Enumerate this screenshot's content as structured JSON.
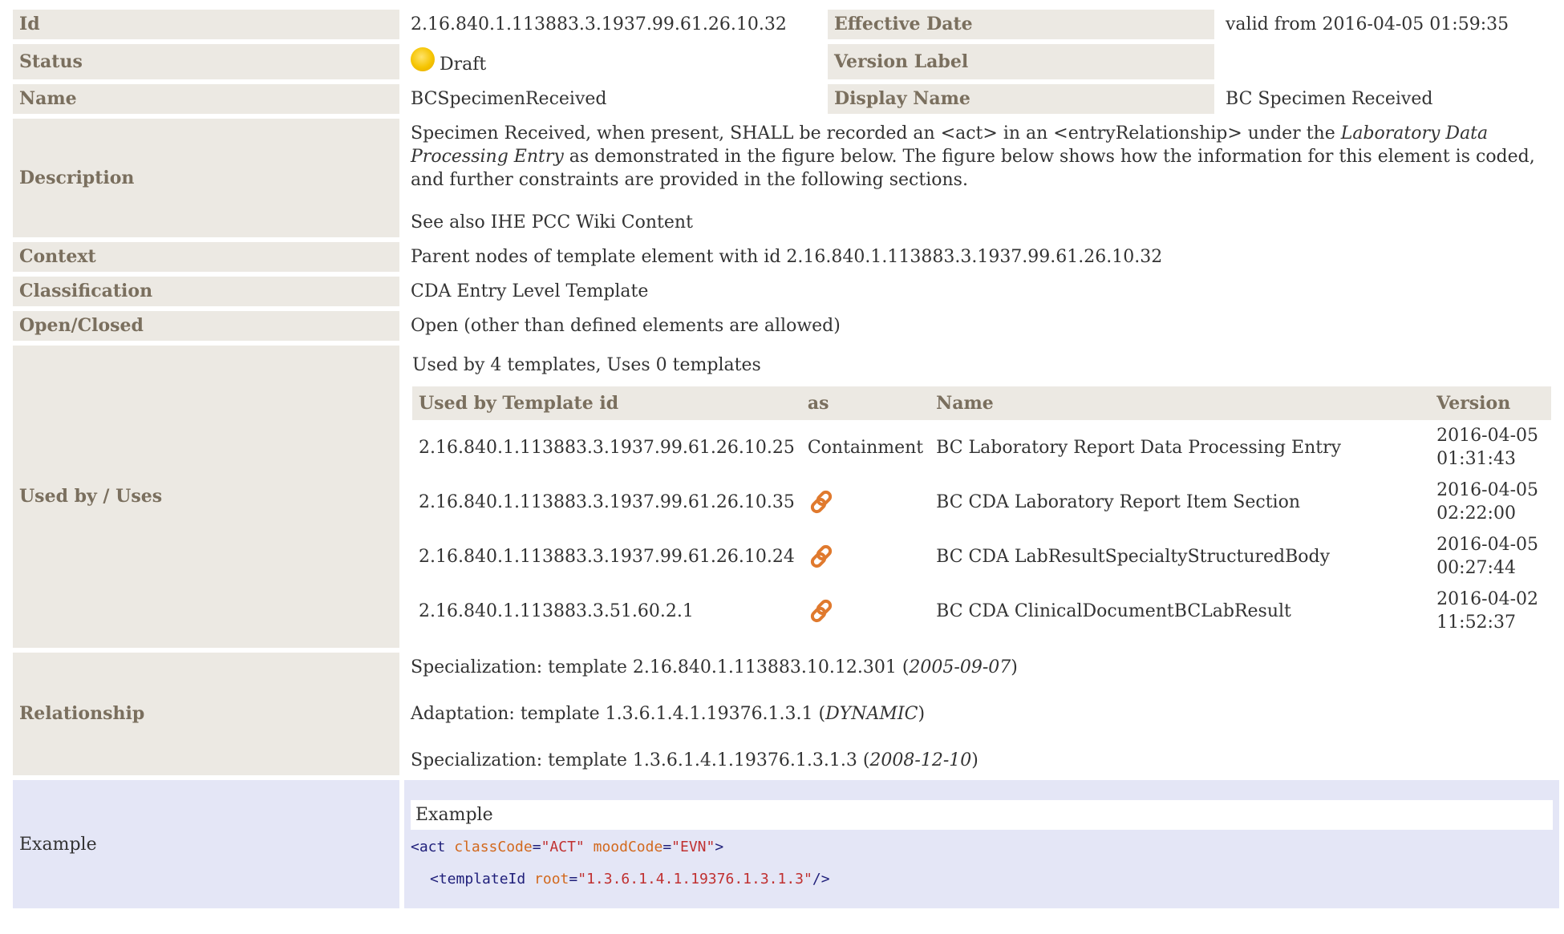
{
  "rows": {
    "id": {
      "label": "Id",
      "value": "2.16.840.1.113883.3.1937.99.61.26.10.32"
    },
    "effective_date": {
      "label": "Effective Date",
      "value": "valid from 2016-04-05 01:59:35"
    },
    "status": {
      "label": "Status",
      "value": "Draft"
    },
    "version_label": {
      "label": "Version Label",
      "value": ""
    },
    "name": {
      "label": "Name",
      "value": "BCSpecimenReceived"
    },
    "display_name": {
      "label": "Display Name",
      "value": "BC Specimen Received"
    },
    "description": {
      "label": "Description",
      "p1_a": "Specimen Received, when present, SHALL be recorded an <act> in an <entryRelationship> under the ",
      "p1_em": "Laboratory Data Processing Entry",
      "p1_b": " as demonstrated in the figure below. The figure below shows how the information for this element is coded, and further constraints are provided in the following sections.",
      "p2": "See also IHE PCC Wiki Content"
    },
    "context": {
      "label": "Context",
      "value": "Parent nodes of template element with id 2.16.840.1.113883.3.1937.99.61.26.10.32"
    },
    "classification": {
      "label": "Classification",
      "value": "CDA Entry Level Template"
    },
    "open_closed": {
      "label": "Open/Closed",
      "value": "Open (other than defined elements are allowed)"
    },
    "used_by": {
      "label": "Used by / Uses",
      "caption": "Used by 4 templates, Uses 0 templates",
      "headers": {
        "id": "Used by Template id",
        "as": "as",
        "name": "Name",
        "version": "Version"
      },
      "items": [
        {
          "id": "2.16.840.1.113883.3.1937.99.61.26.10.25",
          "as": "Containment",
          "as_icon": "",
          "name": "BC Laboratory Report Data Processing Entry",
          "version_date": "2016-04-05",
          "version_time": "01:31:43"
        },
        {
          "id": "2.16.840.1.113883.3.1937.99.61.26.10.35",
          "as": "",
          "as_icon": "link-icon",
          "name": "BC CDA Laboratory Report Item Section",
          "version_date": "2016-04-05",
          "version_time": "02:22:00"
        },
        {
          "id": "2.16.840.1.113883.3.1937.99.61.26.10.24",
          "as": "",
          "as_icon": "link-icon",
          "name": "BC CDA LabResultSpecialtyStructuredBody",
          "version_date": "2016-04-05",
          "version_time": "00:27:44"
        },
        {
          "id": "2.16.840.1.113883.3.51.60.2.1",
          "as": "",
          "as_icon": "link-icon",
          "name": "BC CDA ClinicalDocumentBCLabResult",
          "version_date": "2016-04-02",
          "version_time": "11:52:37"
        }
      ]
    },
    "relationship": {
      "label": "Relationship",
      "items": [
        {
          "prefix": "Specialization: template 2.16.840.1.113883.10.12.301 (",
          "em": "2005-09-07",
          "suffix": ")"
        },
        {
          "prefix": "Adaptation: template 1.3.6.1.4.1.19376.1.3.1 (",
          "em": "DYNAMIC",
          "suffix": ")"
        },
        {
          "prefix": "Specialization: template 1.3.6.1.4.1.19376.1.3.1.3 (",
          "em": "2008-12-10",
          "suffix": ")"
        }
      ]
    },
    "example": {
      "label": "Example",
      "title": "Example",
      "line1": {
        "open": "<act ",
        "attr1": "classCode",
        "eq1": "=",
        "val1": "\"ACT\"",
        "sp": " ",
        "attr2": "moodCode",
        "eq2": "=",
        "val2": "\"EVN\"",
        "close": ">"
      },
      "line2": {
        "open": "<templateId ",
        "attr1": "root",
        "eq1": "=",
        "val1": "\"1.3.6.1.4.1.19376.1.3.1.3\"",
        "close": "/>"
      }
    }
  },
  "colors": {
    "label_bg": "#ece9e3",
    "label_text": "#7a6f5e",
    "example_bg": "#e4e6f6",
    "status_dot": "#f5c400",
    "link_icon": "#e07a2e"
  }
}
